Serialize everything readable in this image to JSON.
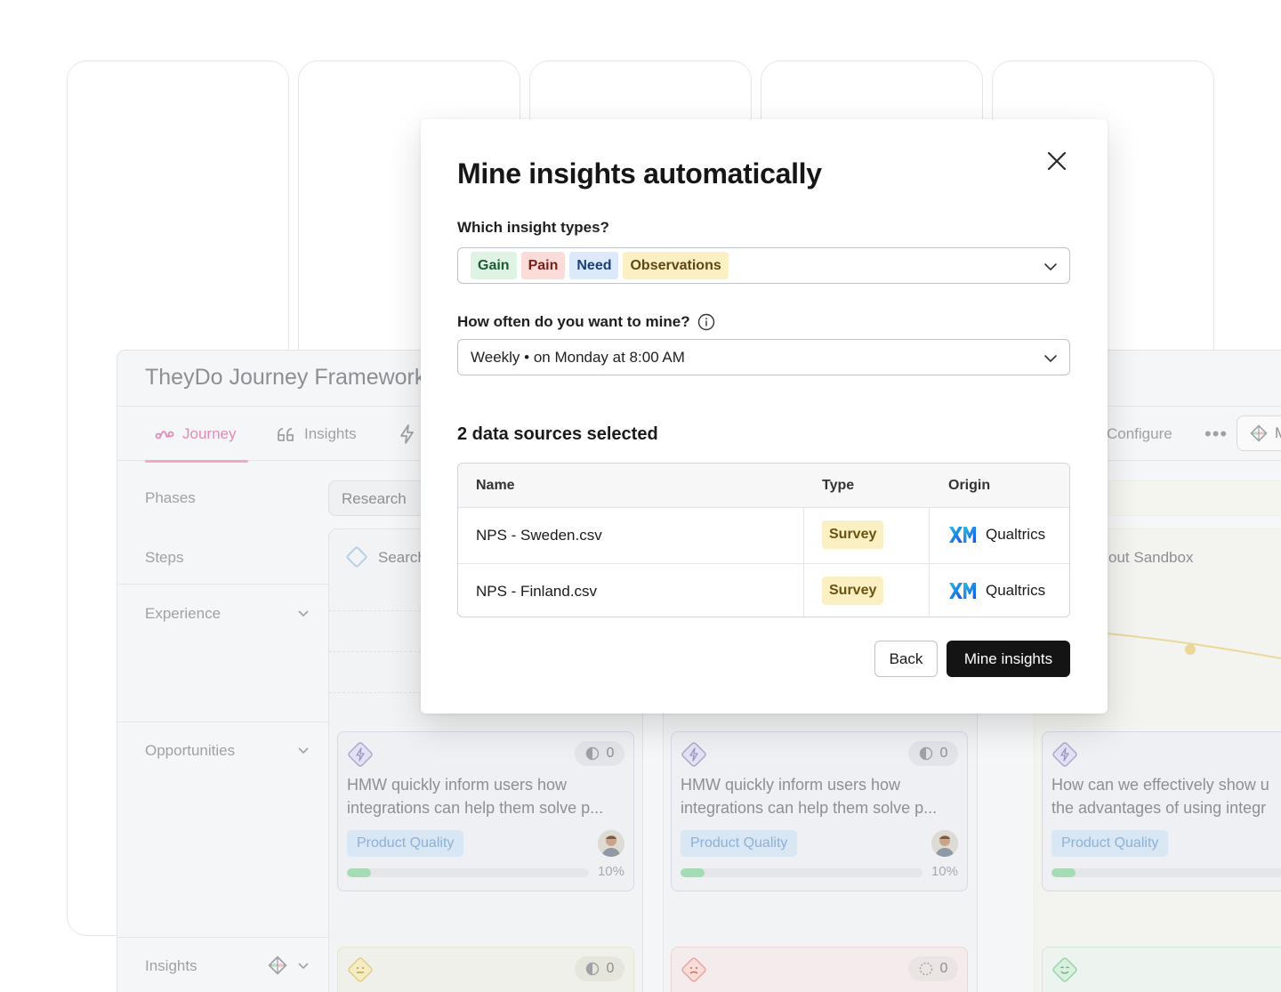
{
  "board": {
    "title": "TheyDo Journey Framework",
    "tabs": [
      {
        "label": "Journey",
        "icon": "journey-icon",
        "active": true
      },
      {
        "label": "Insights",
        "icon": "quote-icon",
        "active": false
      },
      {
        "label": "",
        "icon": "lightning-icon",
        "active": false
      },
      {
        "label": "Configure",
        "icon": "",
        "active": false
      }
    ],
    "more_label": "•••",
    "m_button_label": "M",
    "rows": {
      "phases": "Phases",
      "steps": "Steps",
      "experience": "Experience",
      "opportunities": "Opportunities",
      "insights": "Insights"
    },
    "phase_label": "Research",
    "steps": [
      "Search",
      "out Sandbox"
    ],
    "opportunities": [
      {
        "line1": "HMW quickly inform users how",
        "line2": "integrations can help them solve p...",
        "count": "0",
        "tag": "Product Quality",
        "progress": 0.1,
        "progress_label": "10%"
      },
      {
        "line1": "HMW quickly inform users how",
        "line2": "integrations can help them solve p...",
        "count": "0",
        "tag": "Product Quality",
        "progress": 0.1,
        "progress_label": "10%"
      },
      {
        "line1": "How can we effectively show u",
        "line2": "the advantages of using integr",
        "count": "",
        "tag": "Product Quality",
        "progress": 0.1,
        "progress_label": ""
      }
    ],
    "insight_counts": [
      "0",
      "0"
    ]
  },
  "modal": {
    "title": "Mine insights automatically",
    "types_label": "Which insight types?",
    "types": [
      {
        "label": "Gain",
        "bg": "#dff3e4",
        "fg": "#1d5c33"
      },
      {
        "label": "Pain",
        "bg": "#fbdcd8",
        "fg": "#7a1f18"
      },
      {
        "label": "Need",
        "bg": "#dbe9fb",
        "fg": "#1d3f73"
      },
      {
        "label": "Observations",
        "bg": "#fbefc4",
        "fg": "#5f4710"
      }
    ],
    "frequency_label": "How often do you want to mine?",
    "frequency_value": "Weekly • on Monday at 8:00 AM",
    "sources_title": "2 data sources selected",
    "table": {
      "headers": {
        "name": "Name",
        "type": "Type",
        "origin": "Origin"
      },
      "rows": [
        {
          "name": "NPS - Sweden.csv",
          "type": "Survey",
          "origin": "Qualtrics"
        },
        {
          "name": "NPS - Finland.csv",
          "type": "Survey",
          "origin": "Qualtrics"
        }
      ]
    },
    "back_label": "Back",
    "primary_label": "Mine insights"
  }
}
